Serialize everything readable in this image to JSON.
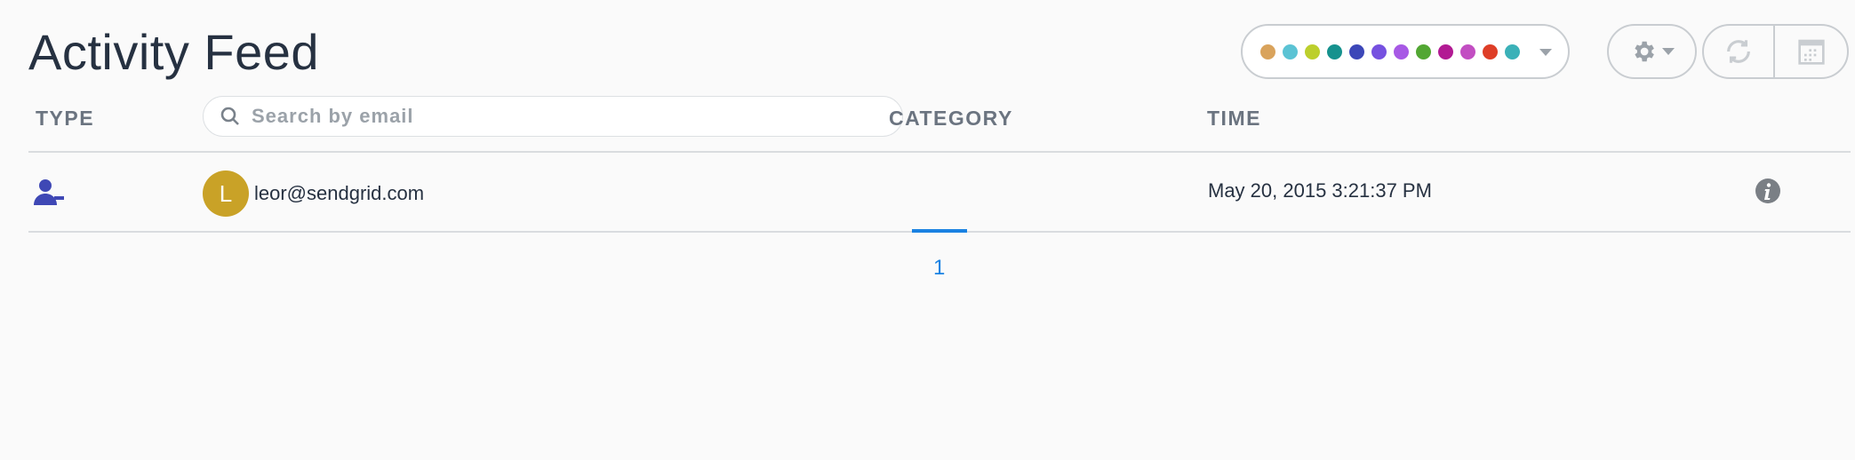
{
  "header": {
    "title": "Activity Feed"
  },
  "color_filter": {
    "dots": [
      {
        "color": "#d9a35c"
      },
      {
        "color": "#5bc3d4"
      },
      {
        "color": "#bccf2c"
      },
      {
        "color": "#16928e"
      },
      {
        "color": "#3c47b8"
      },
      {
        "color": "#7651e0"
      },
      {
        "color": "#a759e5"
      },
      {
        "color": "#52a733"
      },
      {
        "color": "#b21a93"
      },
      {
        "color": "#c24ec2"
      },
      {
        "color": "#de3e27"
      },
      {
        "color": "#3bb1b8"
      }
    ],
    "caret_icon": "chevron-down-icon"
  },
  "toolbar": {
    "settings_icon": "gear-icon",
    "refresh_icon": "refresh-icon",
    "calendar_icon": "calendar-icon"
  },
  "table": {
    "columns": {
      "type": "TYPE",
      "category": "CATEGORY",
      "time": "TIME"
    },
    "search": {
      "placeholder": "Search by email",
      "value": ""
    },
    "rows": [
      {
        "type_icon": "unsubscribe-user-icon",
        "avatar_letter": "L",
        "email": "leor@sendgrid.com",
        "category": "",
        "time": "May 20, 2015 3:21:37 PM",
        "info_icon": "info-icon"
      }
    ]
  },
  "pagination": {
    "current": "1"
  },
  "colors": {
    "accent": "#1a82e2",
    "row_icon": "#3f48b5",
    "avatar": "#c9a227"
  }
}
